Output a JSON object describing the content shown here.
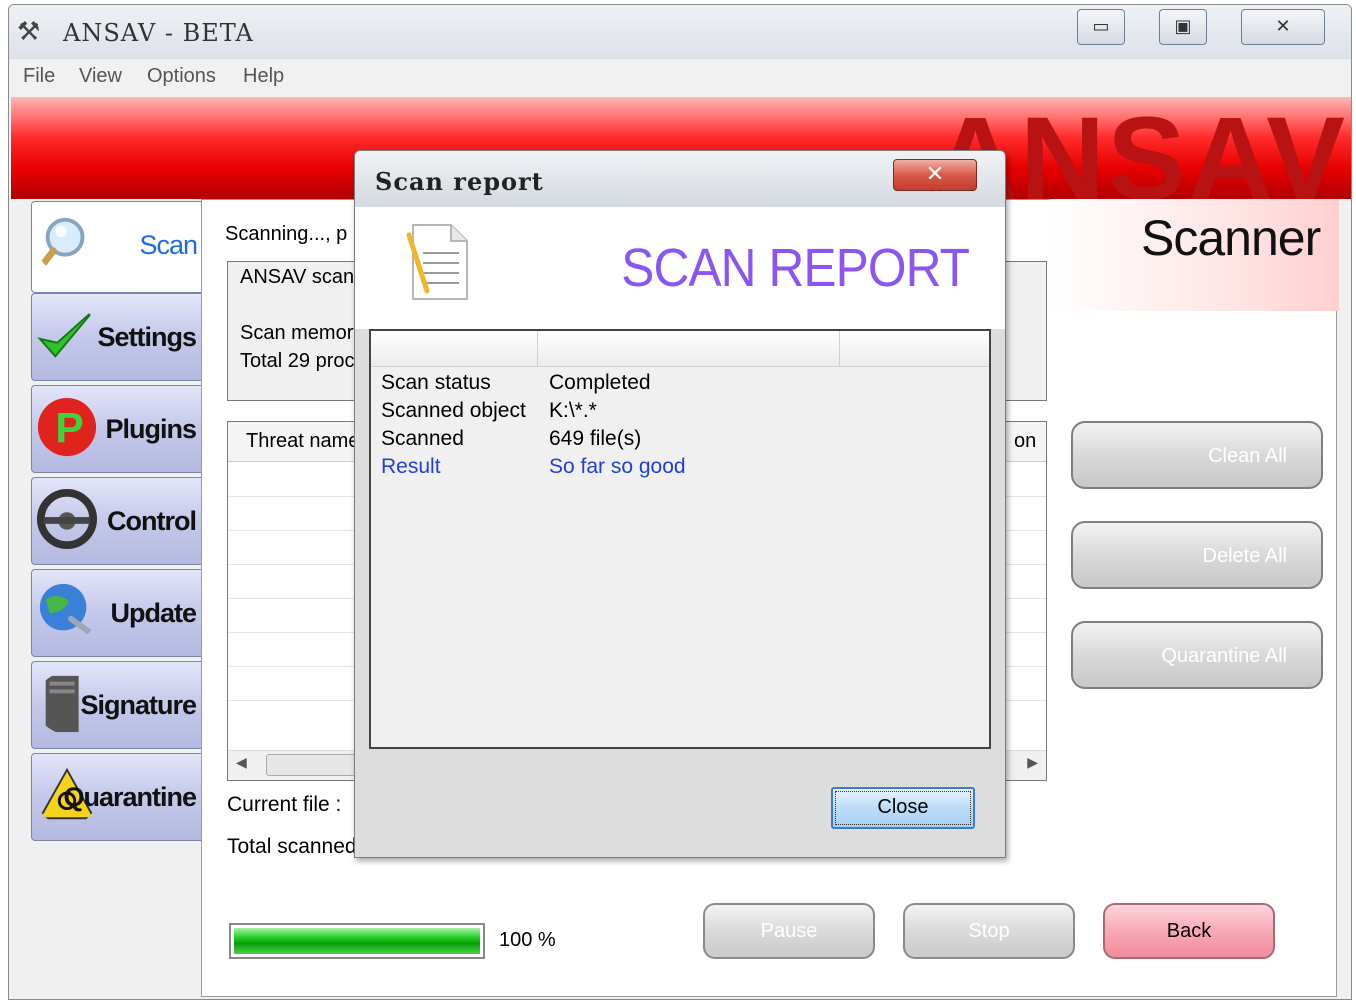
{
  "window": {
    "title": "ANSAV - BETA",
    "controls": {
      "minimize": "▭",
      "maximize": "▣",
      "close": "✕"
    }
  },
  "menu": [
    "File",
    "View",
    "Options",
    "Help"
  ],
  "banner": {
    "logo_text": "ANSAV"
  },
  "section_title": "Scanner",
  "nav": [
    {
      "label": "Scan",
      "icon": "magnifier-icon",
      "active": true
    },
    {
      "label": "Settings",
      "icon": "checkmark-icon"
    },
    {
      "label": "Plugins",
      "icon": "plugin-p-icon"
    },
    {
      "label": "Control",
      "icon": "steering-wheel-icon"
    },
    {
      "label": "Update",
      "icon": "globe-update-icon"
    },
    {
      "label": "Signature",
      "icon": "server-tower-icon"
    },
    {
      "label": "Quarantine",
      "icon": "biohazard-icon"
    }
  ],
  "scan": {
    "status_text": "Scanning..., p",
    "info_lines": [
      "ANSAV scann",
      "Scan memory",
      "Total 29 proc"
    ],
    "threat_columns": [
      "Threat name",
      "on"
    ],
    "current_file_label": "Current file :",
    "total_scanned_label": "Total scanned",
    "progress": {
      "value": 1.0,
      "label": "100 %"
    }
  },
  "actions": {
    "clean_all": "Clean All",
    "delete_all": "Delete All",
    "quarantine_all": "Quarantine All",
    "pause": "Pause",
    "stop": "Stop",
    "back": "Back"
  },
  "dialog": {
    "title": "Scan report",
    "close_glyph": "✕",
    "header_title": "SCAN REPORT",
    "rows": [
      {
        "key": "Scan status",
        "value": "Completed",
        "highlight": false
      },
      {
        "key": "Scanned object",
        "value": "K:\\*.*",
        "highlight": false
      },
      {
        "key": "Scanned",
        "value": "649 file(s)",
        "highlight": false
      },
      {
        "key": "Result",
        "value": "So far so good",
        "highlight": true
      }
    ],
    "close_button": "Close"
  },
  "colors": {
    "accent_red": "#e80000",
    "nav_active_text": "#1b6de0",
    "report_title": "#8a55f3",
    "result_text": "#1f3fd8",
    "progress_green": "#1bc81b",
    "back_button": "#f8a9b6"
  }
}
